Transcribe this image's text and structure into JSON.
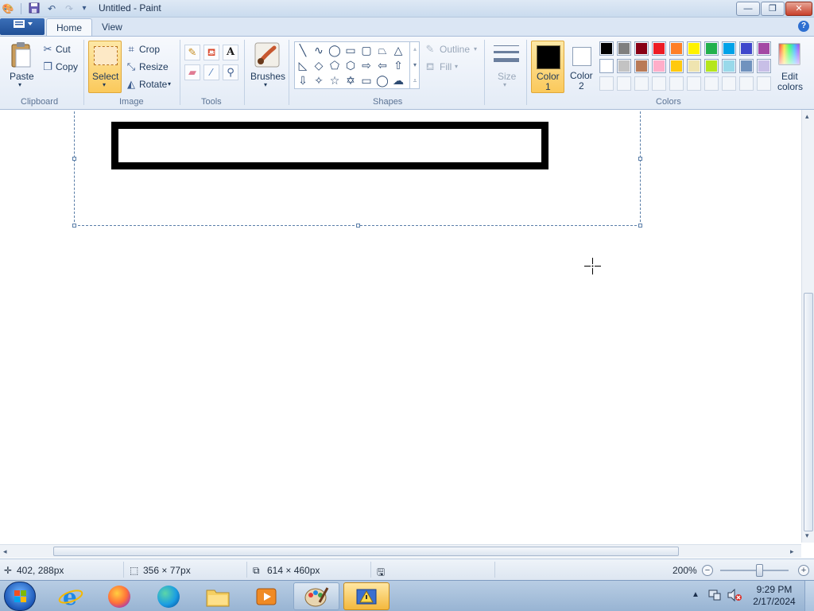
{
  "window": {
    "title": "Untitled - Paint",
    "minimize": "—",
    "maximize": "❐",
    "close": "✕"
  },
  "tabs": [
    {
      "label": "Home"
    },
    {
      "label": "View"
    }
  ],
  "ribbon": {
    "clipboard": {
      "paste": "Paste",
      "cut": "Cut",
      "copy": "Copy",
      "group": "Clipboard"
    },
    "image": {
      "select": "Select",
      "crop": "Crop",
      "resize": "Resize",
      "rotate": "Rotate",
      "group": "Image"
    },
    "tools": {
      "group": "Tools"
    },
    "brushes": {
      "label": "Brushes"
    },
    "shapes": {
      "outline": "Outline",
      "fill": "Fill",
      "group": "Shapes"
    },
    "size": {
      "label": "Size"
    },
    "colors": {
      "color1_line1": "Color",
      "color1_line2": "1",
      "color2_line1": "Color",
      "color2_line2": "2",
      "edit_line1": "Edit",
      "edit_line2": "colors",
      "group": "Colors",
      "color1": "#000000",
      "color2": "#ffffff",
      "palette_row1": [
        "#000000",
        "#7f7f7f",
        "#880015",
        "#ed1c24",
        "#ff7f27",
        "#fff200",
        "#22b14c",
        "#00a2e8",
        "#3f48cc",
        "#a349a4"
      ],
      "palette_row2": [
        "#ffffff",
        "#c3c3c3",
        "#b97a57",
        "#ffaec9",
        "#ffc90e",
        "#efe4b0",
        "#b5e61d",
        "#99d9ea",
        "#7092be",
        "#c8bfe7"
      ]
    }
  },
  "status": {
    "cursor_pos": "402, 288px",
    "selection_size": "356 × 77px",
    "image_size": "614 × 460px",
    "zoom": "200%"
  },
  "taskbar": {
    "time": "9:29 PM",
    "date": "2/17/2024",
    "apps": [
      "internet-explorer",
      "firefox",
      "edge",
      "file-explorer",
      "media-player",
      "paint",
      "app-active"
    ]
  }
}
